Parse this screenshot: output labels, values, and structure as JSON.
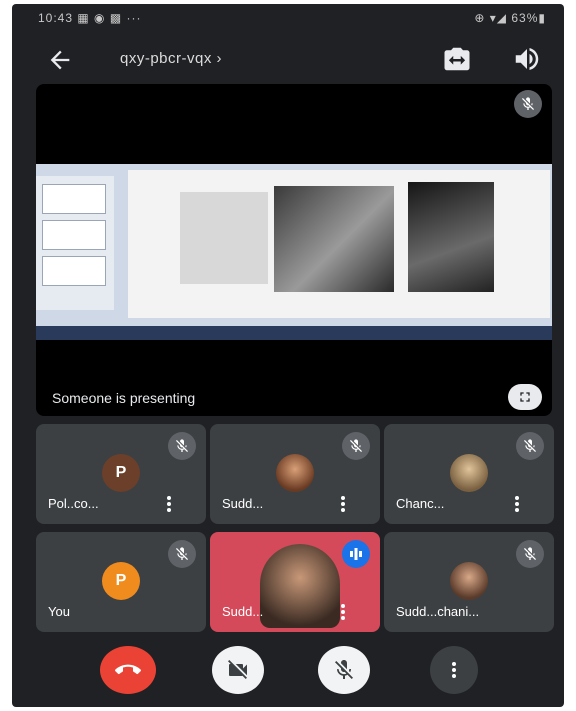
{
  "status_bar": {
    "left": "10:43  ▦ ◉ ▩ ···",
    "right": "⊕ ▾◢  63%▮"
  },
  "top_bar": {
    "meeting_code": "qxy-pbcr-vqx ›"
  },
  "presentation": {
    "label": "Someone is presenting"
  },
  "participants": [
    {
      "name": "Pol..co...",
      "initial": "P",
      "avatar_color": "#6b3f2a",
      "muted": true,
      "has_photo": false
    },
    {
      "name": "Sudd...",
      "initial": "",
      "avatar_color": "#8a5a3a",
      "muted": true,
      "has_photo": true
    },
    {
      "name": "Chanc...",
      "initial": "",
      "avatar_color": "#b79a6a",
      "muted": true,
      "has_photo": true
    },
    {
      "name": "You",
      "initial": "P",
      "avatar_color": "#f08b1e",
      "muted": true,
      "has_photo": false
    },
    {
      "name": "Sudd...",
      "initial": "",
      "avatar_color": "#d44a5a",
      "muted": false,
      "speaking": true,
      "has_photo": true
    },
    {
      "name": "Sudd...chani...",
      "initial": "",
      "avatar_color": "#8a5a4a",
      "muted": true,
      "has_photo": true
    }
  ],
  "colors": {
    "end_call": "#ea4335",
    "speaking_indicator": "#1a73e8",
    "tile_bg": "#3c4043",
    "screen_bg": "#202124"
  },
  "icons": [
    "back-arrow-icon",
    "switch-camera-icon",
    "speaker-icon",
    "mic-off-icon",
    "fullscreen-icon",
    "more-vert-icon",
    "call-end-icon",
    "camera-off-icon",
    "mic-icon",
    "speaking-icon"
  ]
}
